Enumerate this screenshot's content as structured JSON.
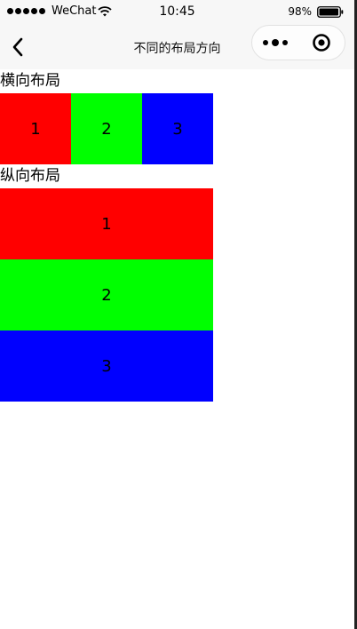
{
  "status_bar": {
    "carrier": "WeChat",
    "time": "10:45",
    "battery": "98%",
    "signal_icon": "signal-dots-icon",
    "wifi_icon": "wifi-icon",
    "battery_icon": "battery-icon"
  },
  "nav": {
    "title": "不同的布局方向",
    "back_icon": "chevron-left-icon",
    "more_icon": "more-dots-icon",
    "close_icon": "target-circle-icon"
  },
  "sections": {
    "horizontal": {
      "title": "横向布局",
      "items": [
        {
          "label": "1",
          "color": "#ff0000"
        },
        {
          "label": "2",
          "color": "#00ff00"
        },
        {
          "label": "3",
          "color": "#0000ff"
        }
      ]
    },
    "vertical": {
      "title": "纵向布局",
      "items": [
        {
          "label": "1",
          "color": "#ff0000"
        },
        {
          "label": "2",
          "color": "#00ff00"
        },
        {
          "label": "3",
          "color": "#0000ff"
        }
      ]
    }
  }
}
